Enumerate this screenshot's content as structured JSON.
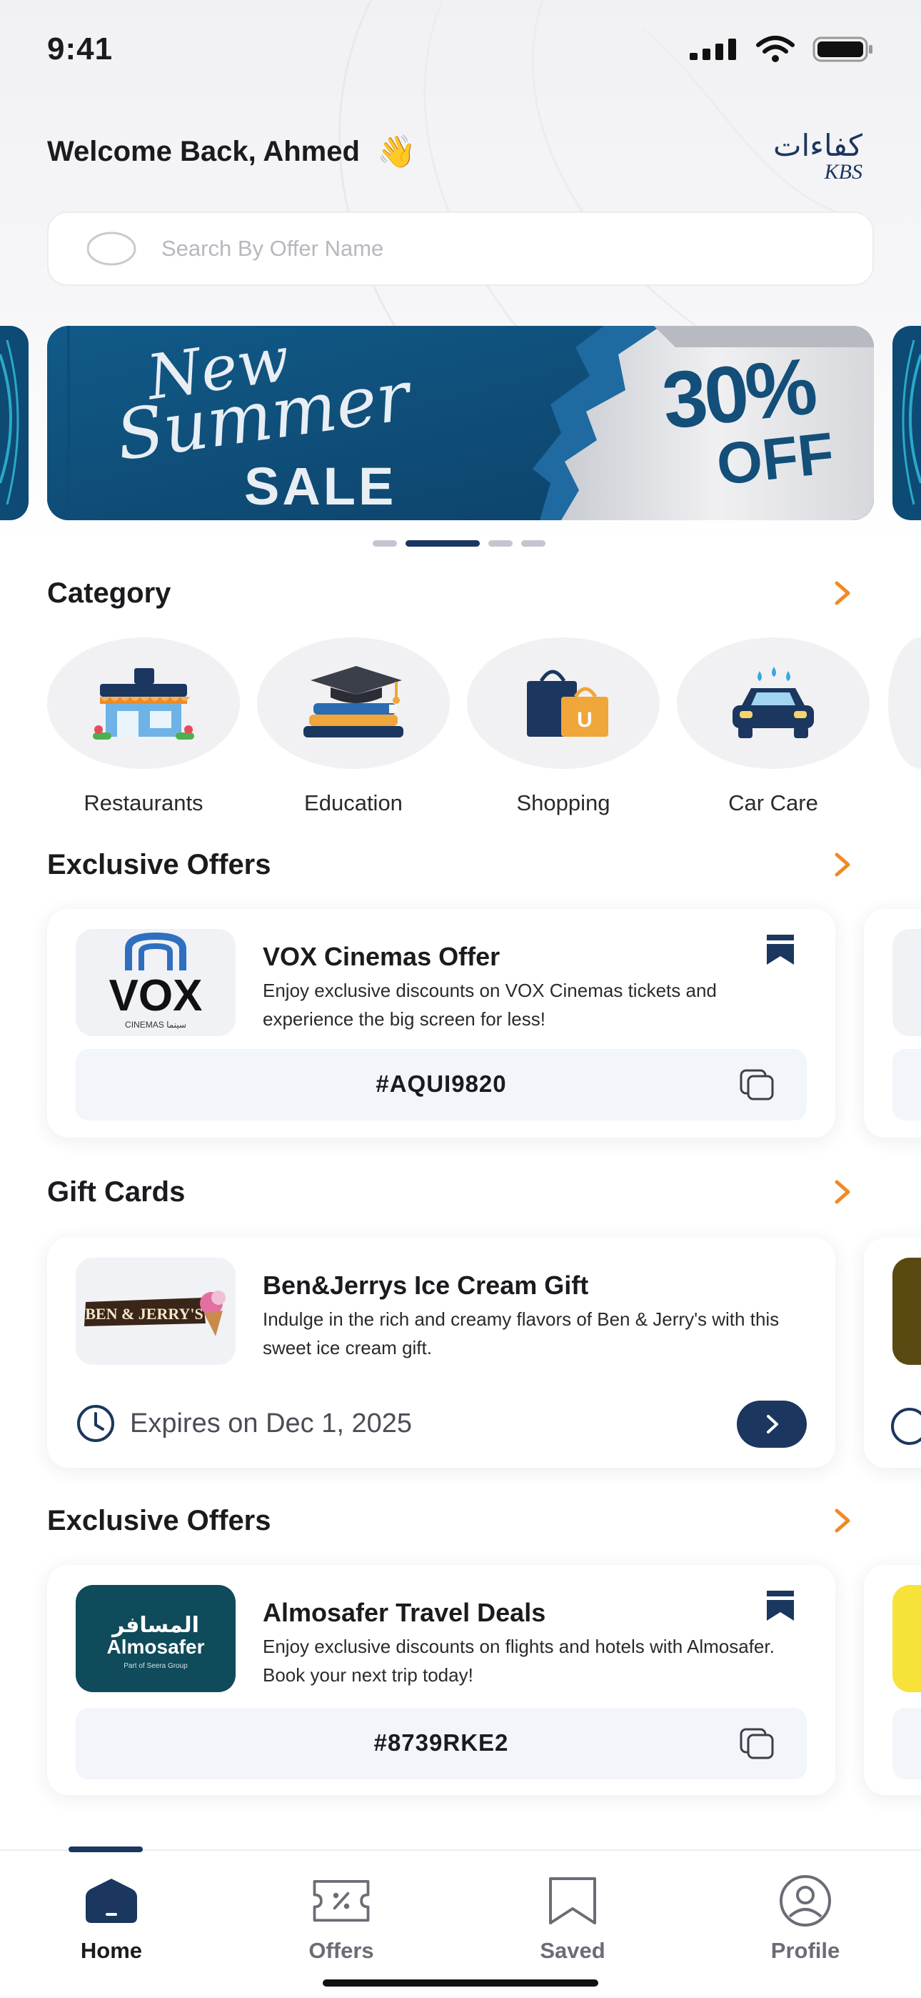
{
  "status_bar": {
    "time": "9:41"
  },
  "header": {
    "welcome": "Welcome Back, Ahmed",
    "wave_emoji": "👋",
    "logo_arabic": "كفاءات",
    "logo_latin": "KBS"
  },
  "search": {
    "placeholder": "Search By Offer Name"
  },
  "banner": {
    "line1": "New",
    "line2": "Summer",
    "line3": "SALE",
    "discount_value": "30%",
    "discount_label": "OFF",
    "slide_count": 4,
    "active_slide": 2
  },
  "sections": {
    "category": {
      "title": "Category"
    },
    "exclusive_1": {
      "title": "Exclusive Offers"
    },
    "gift_cards": {
      "title": "Gift Cards"
    },
    "exclusive_2": {
      "title": "Exclusive Offers"
    }
  },
  "categories": [
    {
      "label": "Restaurants",
      "icon": "restaurant-icon"
    },
    {
      "label": "Education",
      "icon": "education-icon"
    },
    {
      "label": "Shopping",
      "icon": "shopping-bags-icon"
    },
    {
      "label": "Car Care",
      "icon": "car-wash-icon"
    }
  ],
  "offers": [
    {
      "title": "VOX Cinemas Offer",
      "description": "Enjoy exclusive discounts on VOX Cinemas tickets and experience the big screen for less!",
      "code": "#AQUI9820",
      "logo_text": "VOX",
      "logo_sub": "CINEMAS سينما"
    },
    {
      "title": "Almosafer Travel Deals",
      "description": "Enjoy exclusive discounts on flights and hotels with Almosafer. Book your next trip today!",
      "code": "#8739RKE2",
      "logo_arabic": "المسافر",
      "logo_text": "Almosafer",
      "logo_sub": "Part of Seera Group"
    }
  ],
  "gift_card": {
    "title": "Ben&Jerrys Ice Cream Gift",
    "description": "Indulge in the rich and creamy flavors of Ben & Jerry's with this sweet ice cream gift.",
    "expiry": "Expires on Dec 1, 2025",
    "logo_text": "BEN & JERRY'S"
  },
  "nav": [
    {
      "label": "Home",
      "icon": "home-icon",
      "active": true
    },
    {
      "label": "Offers",
      "icon": "offers-ticket-icon",
      "active": false
    },
    {
      "label": "Saved",
      "icon": "bookmark-icon",
      "active": false
    },
    {
      "label": "Profile",
      "icon": "profile-icon",
      "active": false
    }
  ],
  "colors": {
    "primary": "#1b365f",
    "accent_orange": "#f08a24",
    "banner_blue": "#134f79"
  }
}
